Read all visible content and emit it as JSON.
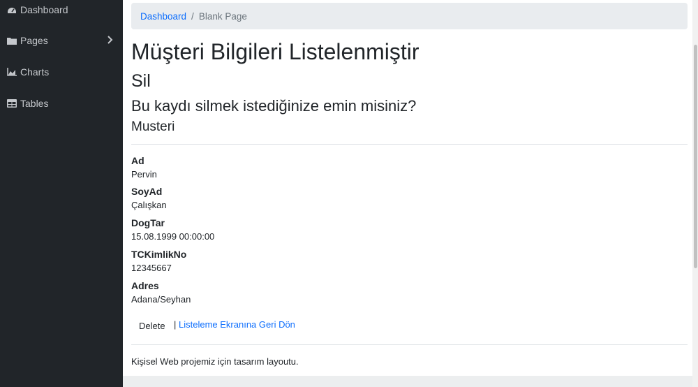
{
  "sidebar": {
    "items": [
      {
        "label": "Dashboard",
        "icon": "tachometer-icon"
      },
      {
        "label": "Pages",
        "icon": "folder-icon"
      },
      {
        "label": "Charts",
        "icon": "area-chart-icon"
      },
      {
        "label": "Tables",
        "icon": "table-icon"
      }
    ]
  },
  "breadcrumb": {
    "link": "Dashboard",
    "separator": "/",
    "current": "Blank Page"
  },
  "main": {
    "title": "Müşteri Bilgileri Listelenmiştir",
    "subtitle": "Sil",
    "question": "Bu kaydı silmek istediğinize emin misiniz?",
    "entity": "Musteri",
    "fields": [
      {
        "label": "Ad",
        "value": "Pervin"
      },
      {
        "label": "SoyAd",
        "value": "Çalışkan"
      },
      {
        "label": "DogTar",
        "value": "15.08.1999 00:00:00"
      },
      {
        "label": "TCKimlikNo",
        "value": "12345667"
      },
      {
        "label": "Adres",
        "value": "Adana/Seyhan"
      }
    ],
    "delete_label": "Delete",
    "pipe": "|",
    "back_link": "Listeleme Ekranına Geri Dön"
  },
  "footer": {
    "text": "Kişisel Web projemiz için tasarım layoutu."
  },
  "colors": {
    "sidebar_bg": "#212529",
    "link": "#0d6efd",
    "breadcrumb_bg": "#e9ecef"
  }
}
